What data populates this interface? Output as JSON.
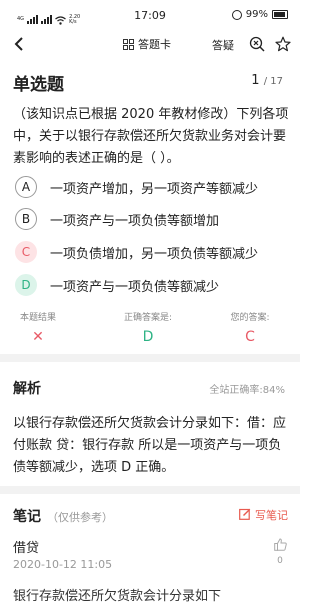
{
  "status": {
    "network": "4G",
    "speed": "2.20",
    "speed_unit": "K/s",
    "time": "17:09",
    "battery": "99%"
  },
  "nav": {
    "answer_card_label": "答题卡",
    "ask_label": "答疑"
  },
  "question": {
    "type": "单选题",
    "current": "1",
    "total": "/ 17",
    "text": "（该知识点已根据 2020 年教材修改）下列各项中，关于以银行存款偿还所欠货款业务对会计要素影响的表述正确的是（ ）。",
    "options": [
      {
        "letter": "A",
        "label": "一项资产增加，另一项资产等额减少",
        "state": "normal"
      },
      {
        "letter": "B",
        "label": "一项资产与一项负债等额增加",
        "state": "normal"
      },
      {
        "letter": "C",
        "label": "一项负债增加，另一项负债等额减少",
        "state": "wrong"
      },
      {
        "letter": "D",
        "label": "一项资产与一项负债等额减少",
        "state": "right"
      }
    ]
  },
  "result": {
    "result_label": "本题结果",
    "result_mark": "✕",
    "correct_label": "正确答案是:",
    "correct_value": "D",
    "yours_label": "您的答案:",
    "yours_value": "C"
  },
  "analysis": {
    "title": "解析",
    "rate": "全站正确率:84%",
    "text": "以银行存款偿还所欠货款会计分录如下：借：应付账款 贷：银行存款 所以是一项资产与一项负债等额减少，选项 D 正确。"
  },
  "notes": {
    "title": "笔记",
    "subtitle": "（仅供参考）",
    "write_label": "写笔记",
    "items": [
      {
        "text": "借贷",
        "date": "2020-10-12 11:05",
        "likes": "0"
      }
    ],
    "next_preview": "银行存款偿还所欠货款会计分录如下"
  },
  "colors": {
    "wrong": "#e85a66",
    "right": "#2eb385",
    "accent": "#e85a4f"
  }
}
